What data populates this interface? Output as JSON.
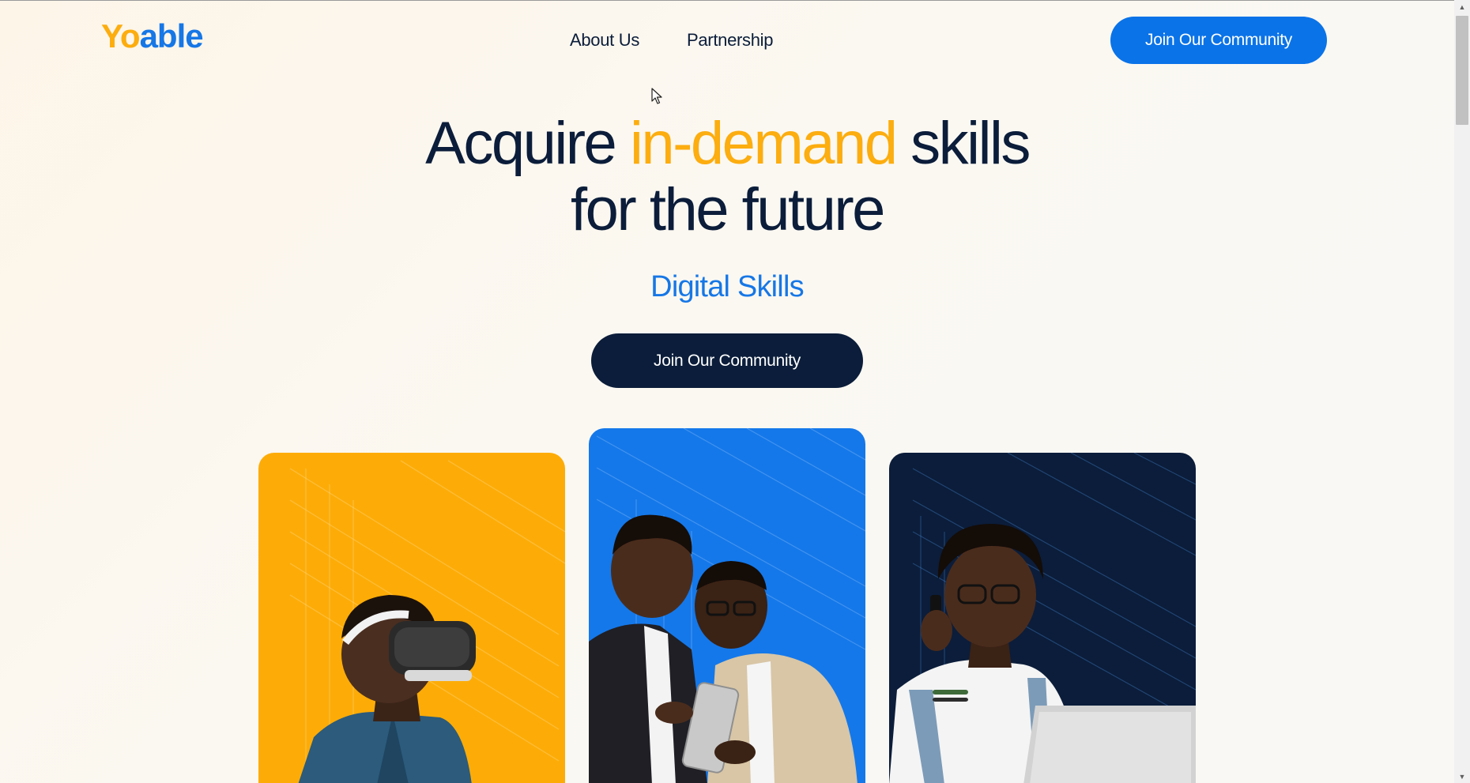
{
  "header": {
    "logo": {
      "part1": "Yo",
      "part2": "able"
    },
    "nav": [
      {
        "label": "About Us"
      },
      {
        "label": "Partnership"
      }
    ],
    "cta_label": "Join Our Community"
  },
  "hero": {
    "title_before": "Acquire ",
    "title_accent": "in-demand",
    "title_after": " skills",
    "title_line2": "for the future",
    "subtitle": "Digital Skills",
    "cta_label": "Join Our Community"
  },
  "cards": [
    {
      "color": "#fdac07",
      "scene": "person-wearing-vr-headset"
    },
    {
      "color": "#1478ea",
      "scene": "two-men-looking-at-tablet"
    },
    {
      "color": "#0b1d3a",
      "scene": "woman-on-phone-with-laptop"
    }
  ],
  "colors": {
    "brand_yellow": "#fcad0f",
    "brand_blue": "#1677e6",
    "navy": "#0b1d3a"
  }
}
